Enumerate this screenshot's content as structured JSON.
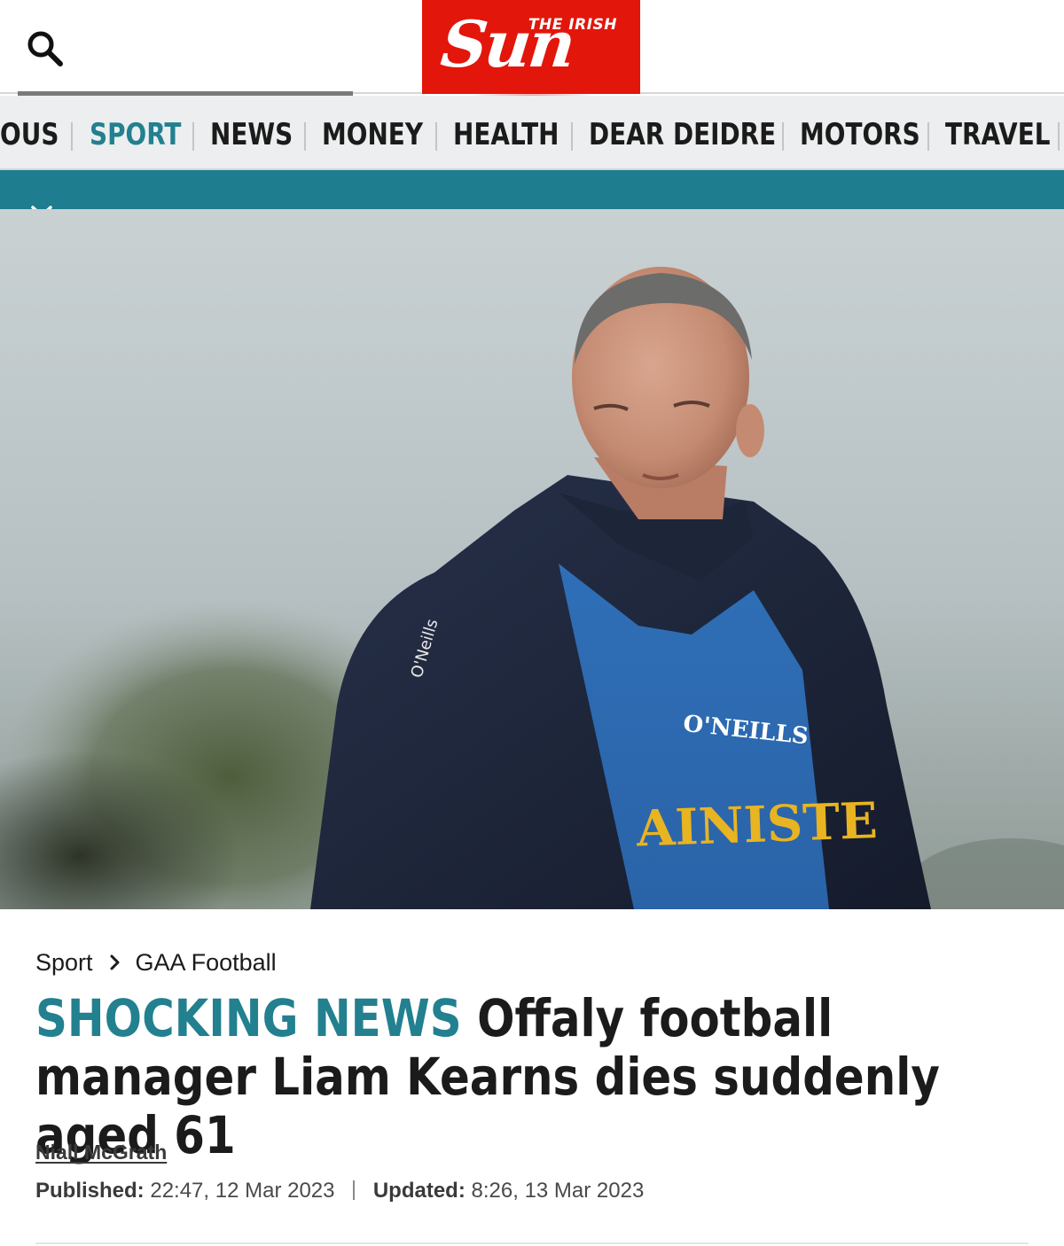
{
  "header": {
    "logo_small": "THE IRISH",
    "logo_big": "Sun",
    "search_icon": "search-icon",
    "brand_color": "#e3160b"
  },
  "nav": {
    "items": [
      {
        "label": "OUS",
        "active": false
      },
      {
        "label": "SPORT",
        "active": true
      },
      {
        "label": "NEWS",
        "active": false
      },
      {
        "label": "MONEY",
        "active": false
      },
      {
        "label": "HEALTH",
        "active": false
      },
      {
        "label": "DEAR DEIDRE",
        "active": false
      },
      {
        "label": "MOTORS",
        "active": false
      },
      {
        "label": "TRAVEL",
        "active": false
      }
    ],
    "accent_color": "#22808f"
  },
  "subnav": {
    "toggle_icon": "chevron-down-icon",
    "bar_color": "#1e7d8e"
  },
  "hero": {
    "jacket_brand": "O'Neills",
    "bib_brand": "O'NEILLS",
    "bib_text": "AINISTE"
  },
  "article": {
    "breadcrumb": {
      "section": "Sport",
      "subsection": "GAA Football"
    },
    "kicker": "SHOCKING NEWS",
    "headline": "Offaly football manager Liam Kearns dies suddenly aged 61",
    "author": "Niall McGrath",
    "published_label": "Published:",
    "published_value": "22:47, 12 Mar 2023",
    "updated_label": "Updated:",
    "updated_value": "8:26, 13 Mar 2023"
  }
}
